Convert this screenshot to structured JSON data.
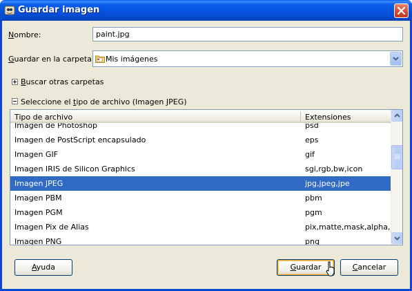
{
  "window": {
    "title": "Guardar imagen"
  },
  "name_row": {
    "label": "Nombre:",
    "value": "paint.jpg"
  },
  "folder_row": {
    "label": "Guardar en la carpeta:",
    "value": "Mis imágenes"
  },
  "browse_expander": {
    "label": "Buscar otras carpetas"
  },
  "filetype_expander": {
    "label": "Seleccione el tipo de archivo (Imagen JPEG)"
  },
  "file_types": {
    "columns": [
      "Tipo de archivo",
      "Extensiones"
    ],
    "rows": [
      {
        "name": "Imagen de Photoshop",
        "ext": "psd"
      },
      {
        "name": "Imagen de PostScript encapsulado",
        "ext": "eps"
      },
      {
        "name": "Imagen GIF",
        "ext": "gif"
      },
      {
        "name": "Imagen IRIS de Silicon Graphics",
        "ext": "sgi,rgb,bw,icon"
      },
      {
        "name": "Imagen JPEG",
        "ext": "jpg,jpeg,jpe",
        "selected": true
      },
      {
        "name": "Imagen PBM",
        "ext": "pbm"
      },
      {
        "name": "Imagen PGM",
        "ext": "pgm"
      },
      {
        "name": "Imagen Pix de Alias",
        "ext": "pix,matte,mask,alpha,als"
      },
      {
        "name": "Imagen PNG",
        "ext": "png"
      }
    ]
  },
  "buttons": {
    "help": "Ayuda",
    "save": "Guardar",
    "cancel": "Cancelar"
  },
  "colors": {
    "titlebar": "#0a5fe9",
    "selection": "#316ac5",
    "dialog_bg": "#ece9d8"
  }
}
